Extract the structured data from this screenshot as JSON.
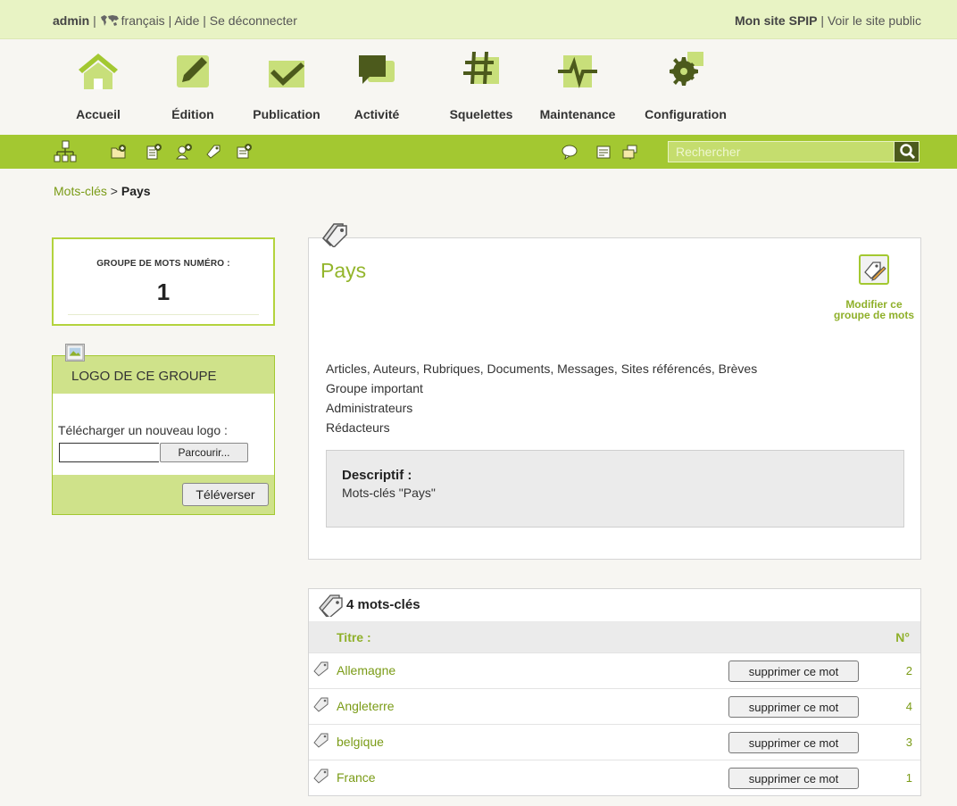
{
  "topbar": {
    "user": "admin",
    "sep": " | ",
    "language": "français",
    "help": "Aide",
    "logout": "Se déconnecter",
    "site_name": "Mon site SPIP",
    "view_public": "Voir le site public"
  },
  "nav": [
    {
      "label": "Accueil",
      "icon": "home-icon"
    },
    {
      "label": "Édition",
      "icon": "pencil-icon"
    },
    {
      "label": "Publication",
      "icon": "checkmark-icon"
    },
    {
      "label": "Activité",
      "icon": "speech-bubble-icon"
    },
    {
      "label": "Squelettes",
      "icon": "hash-icon"
    },
    {
      "label": "Maintenance",
      "icon": "pulse-icon"
    },
    {
      "label": "Configuration",
      "icon": "gear-icon"
    }
  ],
  "search": {
    "placeholder": "Rechercher"
  },
  "breadcrumb": {
    "parent": "Mots-clés",
    "sep": " > ",
    "current": "Pays"
  },
  "group_number": {
    "caption": "GROUPE DE MOTS NUMÉRO :",
    "value": "1"
  },
  "logo": {
    "title": "LOGO DE CE GROUPE",
    "upload_label": "Télécharger un nouveau logo :",
    "browse": "Parcourir...",
    "submit": "Téléverser"
  },
  "group": {
    "title": "Pays",
    "edit_label": "Modifier ce groupe de mots",
    "lines": [
      "Articles, Auteurs, Rubriques, Documents, Messages, Sites référencés, Brèves",
      "Groupe important",
      "Administrateurs",
      "Rédacteurs"
    ],
    "desc_label": "Descriptif :",
    "desc_value": "Mots-clés \"Pays\""
  },
  "keywords": {
    "title": "4 mots-clés",
    "col_title": "Titre :",
    "col_num": "N°",
    "delete_label": "supprimer ce mot",
    "rows": [
      {
        "name": "Allemagne",
        "num": "2"
      },
      {
        "name": "Angleterre",
        "num": "4"
      },
      {
        "name": "belgique",
        "num": "3"
      },
      {
        "name": "France",
        "num": "1"
      }
    ]
  },
  "colors": {
    "accent": "#a3c831",
    "topbar": "#e8f3c4",
    "link": "#7a9b16"
  }
}
